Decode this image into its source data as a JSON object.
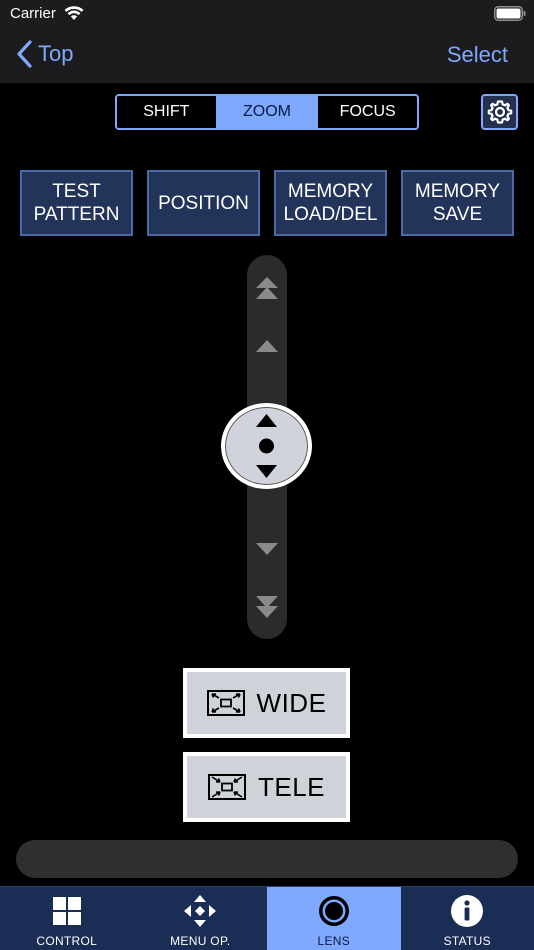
{
  "status_bar": {
    "carrier": "Carrier"
  },
  "nav": {
    "back_label": "Top",
    "select_label": "Select"
  },
  "segmented": {
    "items": [
      {
        "label": "SHIFT",
        "active": false
      },
      {
        "label": "ZOOM",
        "active": true
      },
      {
        "label": "FOCUS",
        "active": false
      }
    ]
  },
  "function_buttons": [
    {
      "label": "TEST\nPATTERN"
    },
    {
      "label": "POSITION"
    },
    {
      "label": "MEMORY\nLOAD/DEL"
    },
    {
      "label": "MEMORY\nSAVE"
    }
  ],
  "zoom": {
    "wide_label": "WIDE",
    "tele_label": "TELE"
  },
  "tabs": [
    {
      "label": "CONTROL",
      "icon": "grid-icon",
      "active": false
    },
    {
      "label": "MENU OP.",
      "icon": "dpad-icon",
      "active": false
    },
    {
      "label": "LENS",
      "icon": "lens-icon",
      "active": true
    },
    {
      "label": "STATUS",
      "icon": "info-icon",
      "active": false
    }
  ],
  "colors": {
    "accent": "#7fa8ff",
    "button_bg": "#223459",
    "tabbar_bg": "#1a2d55"
  }
}
